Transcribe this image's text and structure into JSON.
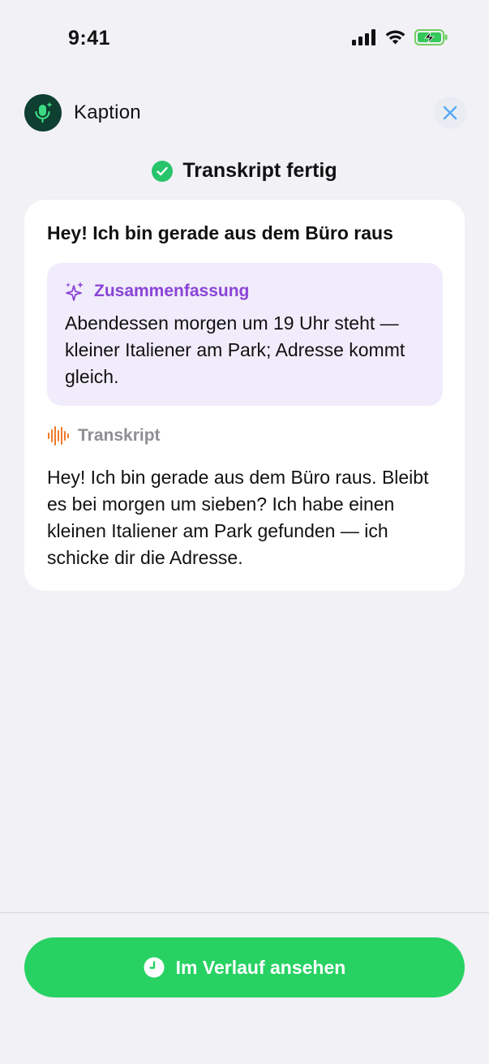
{
  "status_bar": {
    "time": "9:41",
    "icons": [
      "signal-icon",
      "wifi-icon",
      "battery-charging-icon"
    ]
  },
  "header": {
    "app_name": "Kaption",
    "app_icon": "microphone-sparkle-icon",
    "close_icon": "close-icon"
  },
  "status": {
    "icon": "check-circle-icon",
    "label": "Transkript fertig"
  },
  "card": {
    "title": "Hey! Ich bin gerade aus dem Büro raus",
    "summary": {
      "icon": "sparkles-icon",
      "label": "Zusammenfassung",
      "text": "Abendessen morgen um 19 Uhr steht — kleiner Italiener am Park; Adresse kommt gleich."
    },
    "transcript": {
      "icon": "waveform-icon",
      "label": "Transkript",
      "text": "Hey! Ich bin gerade aus dem Büro raus. Bleibt es bei morgen um sieben? Ich habe einen kleinen Italiener am Park gefunden — ich schicke dir die Adresse."
    }
  },
  "footer": {
    "button_icon": "clock-icon",
    "button_label": "Im Verlauf ansehen"
  },
  "colors": {
    "background": "#F2F1F6",
    "accent_green": "#27D263",
    "check_green": "#27C46B",
    "summary_purple": "#8A44D6",
    "summary_bg": "#F1ECFB",
    "transcript_orange": "#F07A2A",
    "close_blue": "#5AA9F2",
    "app_icon_bg": "#0E3F30"
  }
}
